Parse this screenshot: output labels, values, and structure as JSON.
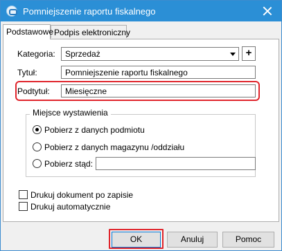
{
  "window": {
    "title": "Pomniejszenie raportu fiskalnego",
    "icon": "app-icon",
    "close_icon": "close-icon"
  },
  "tabs": [
    {
      "label": "Podstawowe",
      "active": true
    },
    {
      "label": "Podpis elektroniczny",
      "active": false
    }
  ],
  "form": {
    "category_label": "Kategoria:",
    "category_value": "Sprzedaż",
    "add_symbol": "+",
    "title_label": "Tytuł:",
    "title_value": "Pomniejszenie raportu fiskalnego",
    "subtitle_label": "Podtytuł:",
    "subtitle_value": "Miesięczne"
  },
  "issue_place": {
    "group_label": "Miejsce wystawienia",
    "options": [
      {
        "label": "Pobierz z danych podmiotu",
        "selected": true
      },
      {
        "label": "Pobierz z danych magazynu /oddziału",
        "selected": false
      },
      {
        "label": "Pobierz stąd:",
        "selected": false
      }
    ],
    "custom_value": ""
  },
  "checkboxes": [
    {
      "label": "Drukuj dokument po zapisie",
      "checked": false
    },
    {
      "label": "Drukuj automatycznie",
      "checked": false
    }
  ],
  "buttons": {
    "ok": "OK",
    "cancel": "Anuluj",
    "help": "Pomoc"
  },
  "colors": {
    "titlebar": "#2b8fd6",
    "highlight": "#e0242b"
  }
}
